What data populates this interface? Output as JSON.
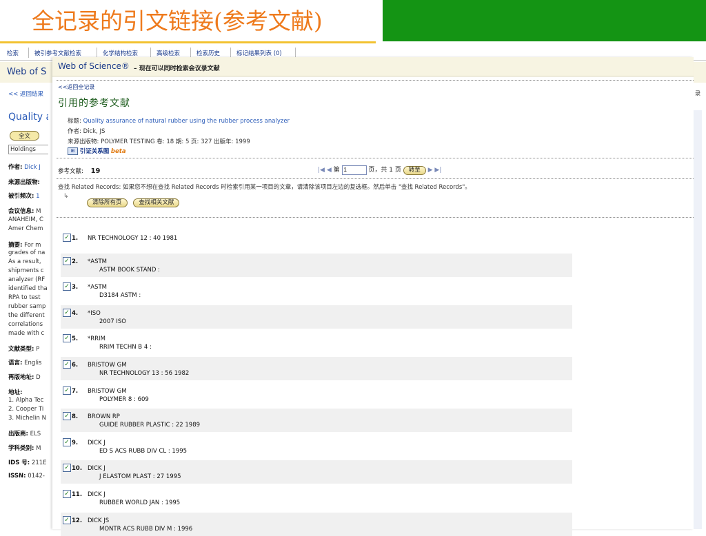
{
  "slide": {
    "title": "全记录的引文链接(参考文献)"
  },
  "nav": {
    "items": [
      "检索",
      "被引参考文献检索",
      "化学结构检索",
      "高级检索",
      "检索历史",
      "标记结果列表 (0)"
    ]
  },
  "background": {
    "wos": "Web of S",
    "back": "<< 返回结果",
    "title_fragment": "Quality a",
    "full_text_btn": "全文",
    "holdings": "Holdings",
    "fields": [
      {
        "label": "作者:",
        "value": "Dick J"
      },
      {
        "label": "来源出版物:",
        "value": ""
      },
      {
        "label": "被引频次:",
        "value": "1"
      },
      {
        "label": "会议信息:",
        "value": "M"
      },
      {
        "label": "",
        "value": "ANAHEIM, C"
      },
      {
        "label": "",
        "value": "Amer Chem"
      },
      {
        "label": "摘要:",
        "value": "For m"
      },
      {
        "label": "",
        "value": "grades of na"
      },
      {
        "label": "",
        "value": "As a result, "
      },
      {
        "label": "",
        "value": "shipments c"
      },
      {
        "label": "",
        "value": "analyzer (RF"
      },
      {
        "label": "",
        "value": "identified tha"
      },
      {
        "label": "",
        "value": "RPA to test "
      },
      {
        "label": "",
        "value": "rubber samp"
      },
      {
        "label": "",
        "value": "the different"
      },
      {
        "label": "",
        "value": "correlations"
      },
      {
        "label": "",
        "value": "made with c"
      },
      {
        "label": "文献类型:",
        "value": "P"
      },
      {
        "label": "语言:",
        "value": "Englis"
      },
      {
        "label": "再版地址:",
        "value": "D"
      },
      {
        "label": "地址:",
        "value": ""
      },
      {
        "label": "",
        "value": "1. Alpha Tec"
      },
      {
        "label": "",
        "value": "2. Cooper Ti"
      },
      {
        "label": "",
        "value": "3. Michelin N"
      },
      {
        "label": "出版商:",
        "value": "ELS"
      },
      {
        "label": "学科类别:",
        "value": "M"
      },
      {
        "label": "IDS 号:",
        "value": "211E"
      },
      {
        "label": "ISSN:",
        "value": "0142-"
      }
    ],
    "right_back": "录"
  },
  "panel": {
    "wos": "Web of Science®",
    "subtitle": "– 现在可以同时检索会议录文献",
    "back_link": "<<返回全记录",
    "heading": "引用的参考文献",
    "title_label": "标题:",
    "title_value": "Quality assurance of natural rubber using the rubber process analyzer",
    "author_label": "作者:",
    "author_value": "Dick, JS",
    "source_line": "来源出版物: POLYMER TESTING 卷: 18 期: 5 页: 327 出版年: 1999",
    "citation_map": "引证关系图",
    "beta": "beta",
    "ref_label": "参考文献:",
    "ref_count": "19",
    "pager_prefix": "第",
    "page_value": "1",
    "pager_suffix": "页，共 1 页",
    "go_btn": "转至",
    "related_text": "查找 Related Records: 如果您不想在查找 Related Records 时检索引用某一项目的文章，请清除该项目左边的复选框。然后单击 \"查找 Related Records\"。",
    "clear_btn": "清除所有页",
    "find_btn": "查找相关文献"
  },
  "references": [
    {
      "num": "1.",
      "line1": "NR TECHNOLOGY 12 : 40 1981",
      "line2": ""
    },
    {
      "num": "2.",
      "line1": "*ASTM",
      "line2": "ASTM BOOK STAND :"
    },
    {
      "num": "3.",
      "line1": "*ASTM",
      "line2": "D3184 ASTM :"
    },
    {
      "num": "4.",
      "line1": "*ISO",
      "line2": "2007 ISO"
    },
    {
      "num": "5.",
      "line1": "*RRIM",
      "line2": "RRIM TECHN B 4 :"
    },
    {
      "num": "6.",
      "line1": "BRISTOW GM",
      "line2": "NR TECHNOLOGY 13 : 56 1982"
    },
    {
      "num": "7.",
      "line1": "BRISTOW GM",
      "line2": "POLYMER 8 : 609"
    },
    {
      "num": "8.",
      "line1": "BROWN RP",
      "line2": "GUIDE RUBBER PLASTIC : 22 1989"
    },
    {
      "num": "9.",
      "line1": "DICK J",
      "line2": "ED S ACS RUBB DIV CL : 1995"
    },
    {
      "num": "10.",
      "line1": "DICK J",
      "line2": "J ELASTOM PLAST : 27 1995"
    },
    {
      "num": "11.",
      "line1": "DICK J",
      "line2": "RUBBER WORLD JAN : 1995"
    },
    {
      "num": "12.",
      "line1": "DICK JS",
      "line2": "MONTR ACS RUBB DIV M : 1996"
    }
  ]
}
